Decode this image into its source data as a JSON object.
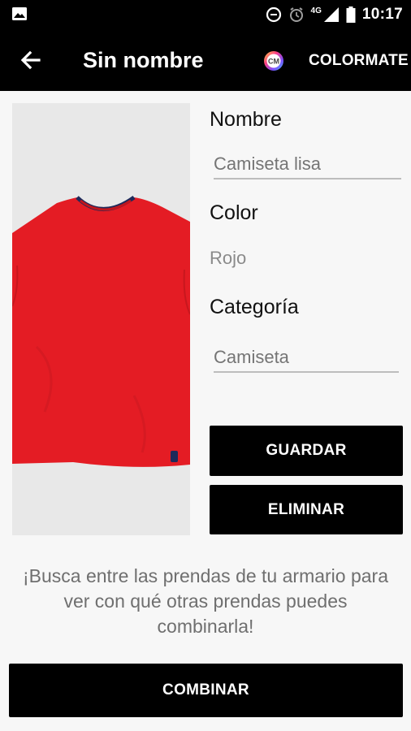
{
  "status_bar": {
    "time": "10:17",
    "network": "4G",
    "icons": [
      "image-icon",
      "data-saver-icon",
      "alarm-icon",
      "signal-icon",
      "battery-icon"
    ]
  },
  "app_bar": {
    "title": "Sin nombre",
    "brand_label": "COLORMATE",
    "logo_text": "CM"
  },
  "garment": {
    "color_hex": "#e41c24"
  },
  "form": {
    "name_label": "Nombre",
    "name_value": "Camiseta lisa",
    "color_label": "Color",
    "color_value": "Rojo",
    "category_label": "Categoría",
    "category_value": "Camiseta"
  },
  "actions": {
    "save_label": "GUARDAR",
    "delete_label": "ELIMINAR",
    "combine_label": "COMBINAR"
  },
  "hint_text": "¡Busca entre las prendas de tu armario para ver con qué otras prendas puedes combinarla!"
}
